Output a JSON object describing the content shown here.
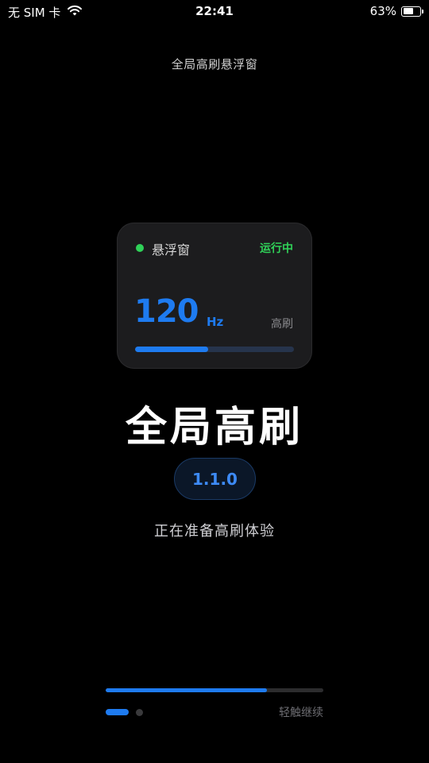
{
  "status_bar": {
    "carrier": "无 SIM 卡",
    "time": "22:41",
    "battery_text": "63%",
    "battery_level": 0.63
  },
  "page_title": "全局高刷悬浮窗",
  "widget": {
    "name": "悬浮窗",
    "status": "运行中",
    "value": "120",
    "unit": "Hz",
    "mode": "高刷",
    "progress": 0.46,
    "status_color": "#30d158",
    "accent_color": "#1e7bf0"
  },
  "app_title": "全局高刷",
  "version": "1.1.0",
  "subtitle": "正在准备高刷体验",
  "bottom": {
    "progress": 0.74,
    "continue_hint": "轻触继续"
  }
}
